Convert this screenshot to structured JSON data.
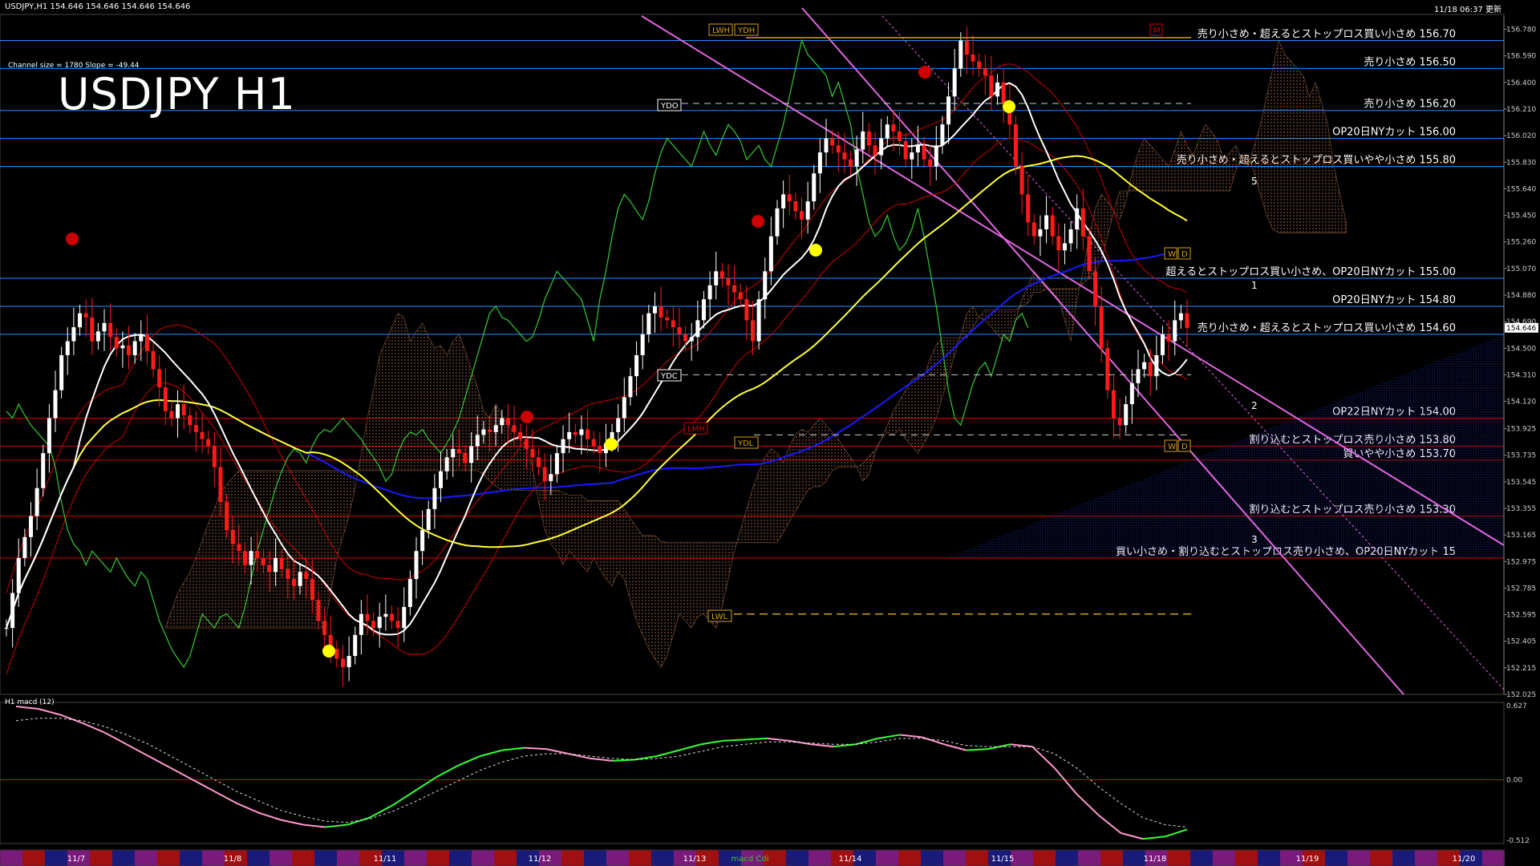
{
  "header": {
    "symbol_info": "USDJPY,H1  154.646 154.646 154.646 154.646",
    "timestamp": "11/18 06:37 更新",
    "channel_info": "Channel size = 1780 Slope = -49.44",
    "title": "USDJPY H1"
  },
  "colors": {
    "background": "#000000",
    "bull_candle": "#ffffff",
    "bear_candle": "#ff1a1a",
    "sma_short": "#ffffff",
    "sma_mid": "#ffff33",
    "sma_long": "#1a1aff",
    "chikou": "#33cc33",
    "bollinger": "#cc0000",
    "level_line": "#1e90ff",
    "level_line_red": "#cc0000",
    "channel": "#e066e0",
    "macd_up": "#33ff33",
    "macd_down": "#ff99cc"
  },
  "chart_data": {
    "type": "candlestick",
    "x_labels": [
      "11/7",
      "11/8",
      "11/11",
      "11/12",
      "11/13",
      "11/14",
      "11/15",
      "11/18",
      "11/19",
      "11/20"
    ],
    "ylim": [
      152.025,
      156.875
    ],
    "y_ticks": [
      "156.780",
      "156.590",
      "156.400",
      "156.210",
      "156.020",
      "155.830",
      "155.640",
      "155.450",
      "155.260",
      "155.070",
      "154.880",
      "154.690",
      "154.500",
      "154.310",
      "154.120",
      "153.925",
      "153.735",
      "153.545",
      "153.355",
      "153.165",
      "152.975",
      "152.785",
      "152.595",
      "152.405",
      "152.215",
      "152.025"
    ],
    "current_price": "154.646",
    "closes": [
      152.5,
      152.75,
      153.0,
      153.15,
      153.3,
      153.5,
      153.75,
      154.0,
      154.2,
      154.45,
      154.55,
      154.65,
      154.75,
      154.72,
      154.55,
      154.62,
      154.68,
      154.58,
      154.5,
      154.52,
      154.45,
      154.55,
      154.6,
      154.48,
      154.35,
      154.22,
      154.05,
      154.0,
      154.1,
      154.02,
      153.95,
      153.9,
      153.85,
      153.8,
      153.65,
      153.4,
      153.2,
      153.1,
      153.05,
      152.95,
      153.05,
      153.0,
      152.95,
      152.9,
      153.0,
      152.92,
      152.85,
      152.8,
      152.9,
      152.85,
      152.7,
      152.55,
      152.45,
      152.35,
      152.28,
      152.22,
      152.3,
      152.45,
      152.6,
      152.55,
      152.5,
      152.58,
      152.6,
      152.55,
      152.5,
      152.65,
      152.85,
      153.05,
      153.2,
      153.35,
      153.5,
      153.62,
      153.72,
      153.78,
      153.75,
      153.68,
      153.8,
      153.88,
      153.92,
      153.9,
      153.95,
      154.0,
      153.95,
      153.9,
      153.85,
      153.78,
      153.72,
      153.65,
      153.55,
      153.6,
      153.75,
      153.85,
      153.9,
      153.88,
      153.92,
      153.85,
      153.8,
      153.75,
      153.82,
      153.9,
      154.0,
      154.15,
      154.3,
      154.45,
      154.6,
      154.75,
      154.8,
      154.72,
      154.7,
      154.65,
      154.6,
      154.55,
      154.58,
      154.7,
      154.85,
      154.95,
      155.05,
      155.0,
      154.95,
      154.9,
      154.85,
      154.7,
      154.55,
      154.85,
      155.05,
      155.3,
      155.5,
      155.6,
      155.55,
      155.48,
      155.42,
      155.55,
      155.75,
      155.9,
      156.0,
      155.95,
      155.9,
      155.85,
      155.8,
      155.92,
      156.05,
      155.95,
      155.88,
      156.0,
      156.1,
      156.05,
      155.98,
      155.85,
      155.9,
      155.95,
      155.85,
      155.8,
      155.95,
      156.1,
      156.3,
      156.5,
      156.7,
      156.6,
      156.55,
      156.5,
      156.45,
      156.3,
      156.4,
      156.25,
      156.1,
      155.8,
      155.6,
      155.4,
      155.3,
      155.35,
      155.45,
      155.3,
      155.2,
      155.25,
      155.35,
      155.5,
      155.3,
      155.05,
      154.8,
      154.5,
      154.2,
      154.0,
      153.95,
      154.1,
      154.25,
      154.35,
      154.4,
      154.3,
      154.45,
      154.6,
      154.55,
      154.7,
      154.75,
      154.646
    ]
  },
  "levels": [
    {
      "price": 156.7,
      "label": "売り小さめ・超えるとストップロス買い小さめ 156.70",
      "color": "#1e90ff"
    },
    {
      "price": 156.5,
      "label": "売り小さめ 156.50",
      "color": "#1e90ff"
    },
    {
      "price": 156.2,
      "label": "売り小さめ 156.20",
      "color": "#1e90ff"
    },
    {
      "price": 156.0,
      "label": "OP20日NYカット 156.00",
      "color": "#1e90ff"
    },
    {
      "price": 155.8,
      "label": "売り小さめ・超えるとストップロス買いやや小さめ 155.80",
      "color": "#1e90ff"
    },
    {
      "price": 155.0,
      "label": "超えるとストップロス買い小さめ、OP20日NYカット 155.00",
      "color": "#1e90ff"
    },
    {
      "price": 154.8,
      "label": "OP20日NYカット 154.80",
      "color": "#1e90ff"
    },
    {
      "price": 154.6,
      "label": "売り小さめ・超えるとストップロス買い小さめ 154.60",
      "color": "#1e90ff"
    },
    {
      "price": 154.0,
      "label": "OP22日NYカット 154.00",
      "color": "#cc0000"
    },
    {
      "price": 153.8,
      "label": "割り込むとストップロス売り小さめ 153.80",
      "color": "#cc0000"
    },
    {
      "price": 153.7,
      "label": "買いやや小さめ 153.70",
      "color": "#cc0000"
    },
    {
      "price": 153.3,
      "label": "割り込むとストップロス売り小さめ 153.30",
      "color": "#cc0000"
    },
    {
      "price": 153.0,
      "label": "買い小さめ・割り込むとストップロス売り小さめ、OP20日NYカット 15",
      "color": "#cc0000"
    }
  ],
  "markers": {
    "lwh": "LWH",
    "ydh": "YDH",
    "ydo": "YDO",
    "ydc": "YDC",
    "ydl": "YDL",
    "lwl": "LWL",
    "lmh": "LMH",
    "m": "M",
    "w": "W",
    "d": "D",
    "wave_labels": [
      "1",
      "2",
      "3",
      "5"
    ]
  },
  "macd": {
    "label": "H1 macd (12)",
    "ticks": [
      "0.627",
      "0.00",
      "-0.512"
    ],
    "values": [
      0.62,
      0.6,
      0.55,
      0.48,
      0.4,
      0.3,
      0.2,
      0.1,
      0.0,
      -0.1,
      -0.2,
      -0.28,
      -0.34,
      -0.38,
      -0.4,
      -0.38,
      -0.32,
      -0.22,
      -0.1,
      0.02,
      0.12,
      0.2,
      0.25,
      0.27,
      0.26,
      0.22,
      0.18,
      0.16,
      0.17,
      0.2,
      0.25,
      0.3,
      0.33,
      0.34,
      0.35,
      0.33,
      0.3,
      0.28,
      0.3,
      0.35,
      0.38,
      0.36,
      0.3,
      0.25,
      0.26,
      0.3,
      0.28,
      0.1,
      -0.12,
      -0.3,
      -0.45,
      -0.5,
      -0.48,
      -0.42
    ],
    "signal": [
      0.5,
      0.52,
      0.52,
      0.5,
      0.45,
      0.38,
      0.3,
      0.2,
      0.1,
      0.0,
      -0.1,
      -0.18,
      -0.26,
      -0.31,
      -0.35,
      -0.36,
      -0.33,
      -0.27,
      -0.19,
      -0.1,
      -0.01,
      0.08,
      0.15,
      0.2,
      0.22,
      0.22,
      0.2,
      0.18,
      0.17,
      0.18,
      0.2,
      0.24,
      0.28,
      0.3,
      0.32,
      0.32,
      0.31,
      0.3,
      0.3,
      0.32,
      0.35,
      0.35,
      0.33,
      0.29,
      0.28,
      0.28,
      0.28,
      0.22,
      0.1,
      -0.06,
      -0.2,
      -0.32,
      -0.38,
      -0.4
    ]
  },
  "macd_legend": "macd Cdi"
}
